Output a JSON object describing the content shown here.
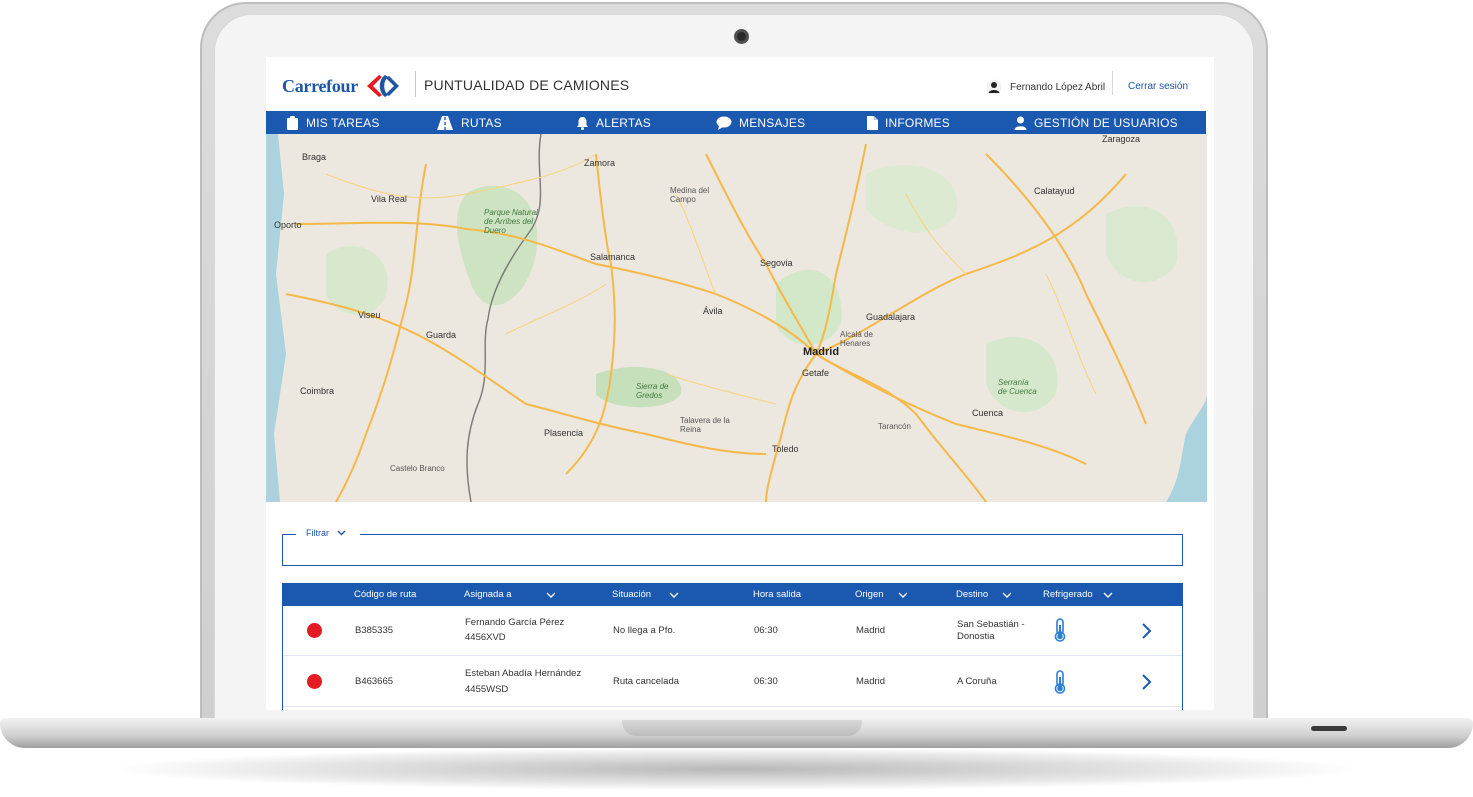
{
  "app": {
    "brand": "Carrefour",
    "title": "PUNTUALIDAD DE CAMIONES",
    "user_name": "Fernando López Abril",
    "logout_label": "Cerrar sesión"
  },
  "nav": {
    "items": [
      {
        "label": "MIS TAREAS",
        "icon": "clipboard-icon"
      },
      {
        "label": "RUTAS",
        "icon": "road-icon"
      },
      {
        "label": "ALERTAS",
        "icon": "bell-icon"
      },
      {
        "label": "MENSAJES",
        "icon": "chat-icon"
      },
      {
        "label": "INFORMES",
        "icon": "document-icon"
      },
      {
        "label": "GESTIÓN DE USUARIOS",
        "icon": "user-icon"
      }
    ]
  },
  "map": {
    "labels": {
      "zaragoza": "Zaragoza",
      "braga": "Braga",
      "zamora": "Zamora",
      "oporto": "Oporto",
      "vila_real": "Vila Real",
      "medina": "Medina del Campo",
      "salamanca": "Salamanca",
      "segovia": "Segovia",
      "avila": "Ávila",
      "guadalajara": "Guadalajara",
      "calatayud": "Calatayud",
      "viseu": "Viseu",
      "guarda": "Guarda",
      "madrid": "Madrid",
      "getafe": "Getafe",
      "alcala": "Alcalá de Henares",
      "coimbra": "Coimbra",
      "plasencia": "Plasencia",
      "talavera": "Talavera de la Reina",
      "toledo": "Toledo",
      "cuenca": "Cuenca",
      "castelo": "Castelo Branco",
      "tarancon": "Tarancón",
      "arribes": "Parque Natural de Arribes del Duero",
      "gredos": "Sierra de Gredos",
      "serrania": "Serranía de Cuenca"
    }
  },
  "filter": {
    "label": "Filtrar"
  },
  "table": {
    "headers": [
      "Código de ruta",
      "Asignada a",
      "Situación",
      "Hora salida",
      "Origen",
      "Destino",
      "Refrigerado"
    ],
    "rows": [
      {
        "code": "B385335",
        "driver": "Fernando García Pérez",
        "plate": "4456XVD",
        "status": "No llega a Pfo.",
        "departure": "06:30",
        "origin": "Madrid",
        "destination_line1": "San Sebastián -",
        "destination_line2": "Donostia",
        "status_color": "#e31c23"
      },
      {
        "code": "B463665",
        "driver": "Esteban Abadía Hernández",
        "plate": "4455WSD",
        "status": "Ruta cancelada",
        "departure": "06:30",
        "origin": "Madrid",
        "destination_line1": "A Coruña",
        "destination_line2": "",
        "status_color": "#e31c23"
      }
    ]
  },
  "colors": {
    "primary": "#1b58b0",
    "brand": "#1e55a5",
    "alert": "#e31c23"
  }
}
